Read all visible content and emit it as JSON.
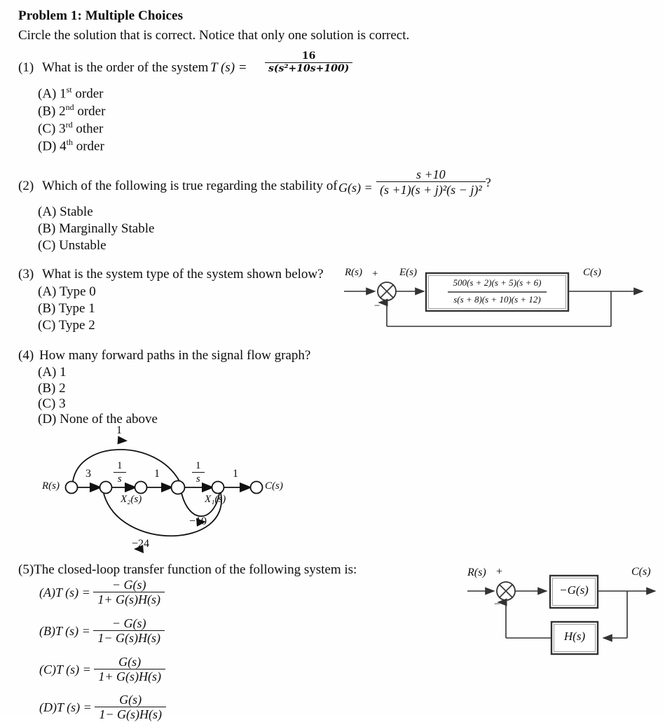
{
  "document": {
    "title": "Problem 1: Multiple Choices",
    "instruction": "Circle the solution that is correct. Notice that only one solution is correct."
  },
  "questions": [
    {
      "number": "(1)",
      "text": "What is the order of the system",
      "formula": {
        "lhs": "T (s)  =",
        "numerator": "16",
        "denominator": "s(s²+10s+100)"
      },
      "choices": [
        {
          "tag": "(A)",
          "value": "1",
          "sup": "st",
          "rest": "order"
        },
        {
          "tag": "(B)",
          "value": "2",
          "sup": "nd",
          "rest": "order"
        },
        {
          "tag": "(C)",
          "value": "3",
          "sup": "rd",
          "rest": "other"
        },
        {
          "tag": "(D)",
          "value": "4",
          "sup": "th",
          "rest": "order"
        }
      ]
    },
    {
      "number": "(2)",
      "text": "Which of the following is true regarding the stability of",
      "formula": {
        "lhs": "G(s) =",
        "numerator": "s +10",
        "denominator": "(s +1)(s + j)²(s − j)²",
        "trailing": "?"
      },
      "choices": [
        {
          "tag": "(A)",
          "label": "Stable"
        },
        {
          "tag": "(B)",
          "label": "Marginally Stable"
        },
        {
          "tag": "(C)",
          "label": "Unstable"
        }
      ]
    },
    {
      "number": "(3)",
      "text": "What is the system type of the system shown below?",
      "choices": [
        {
          "tag": "(A)",
          "label": "Type 0"
        },
        {
          "tag": "(B)",
          "label": "Type 1"
        },
        {
          "tag": "(C)",
          "label": "Type 2"
        }
      ]
    },
    {
      "number": "(4)",
      "text": "How many forward paths in the signal flow graph?",
      "choices": [
        {
          "tag": "(A)",
          "label": "1"
        },
        {
          "tag": "(B)",
          "label": "2"
        },
        {
          "tag": "(C)",
          "label": "3"
        },
        {
          "tag": "(D)",
          "label": "None of the above"
        }
      ]
    },
    {
      "number": "(5)",
      "text": "The closed-loop transfer function of the following system is:",
      "choices": [
        {
          "tag": "(A)",
          "lhs": "T (s) =",
          "numerator": "− G(s)",
          "denominator": "1+ G(s)H(s)"
        },
        {
          "tag": "(B)",
          "lhs": "T (s) =",
          "numerator": "− G(s)",
          "denominator": "1− G(s)H(s)"
        },
        {
          "tag": "(C)",
          "lhs": "T (s) =",
          "numerator": "G(s)",
          "denominator": "1+ G(s)H(s)"
        },
        {
          "tag": "(D)",
          "lhs": "T (s) =",
          "numerator": "G(s)",
          "denominator": "1− G(s)H(s)"
        }
      ]
    }
  ],
  "block_diagram_1": {
    "input_label": "R(s)",
    "plus_sign": "+",
    "minus_sign": "−",
    "error_label": "E(s)",
    "output_label": "C(s)",
    "plant_numerator": "500(s + 2)(s + 5)(s + 6)",
    "plant_denominator": "s(s + 8)(s + 10)(s + 12)"
  },
  "block_diagram_2": {
    "input_label": "R(s)",
    "plus_sign": "+",
    "minus_sign": "−",
    "output_label": "C(s)",
    "forward_block": "−G(s)",
    "feedback_block": "H(s)"
  },
  "signal_flow_graph": {
    "input_node": "R(s)",
    "output_node": "C(s)",
    "node_x2": "X₂(s)",
    "node_x1": "X₁(s)",
    "gain_top": "1",
    "gain_3": "3",
    "gain_int1_num": "1",
    "gain_int1_den": "s",
    "gain_mid": "1",
    "gain_int2_num": "1",
    "gain_int2_den": "s",
    "gain_out": "1",
    "loop_inner": "−10",
    "loop_outer": "−24"
  },
  "colors": {
    "text": "#0d0d0d",
    "line": "#2b2b2b",
    "page": "#fefefe"
  }
}
